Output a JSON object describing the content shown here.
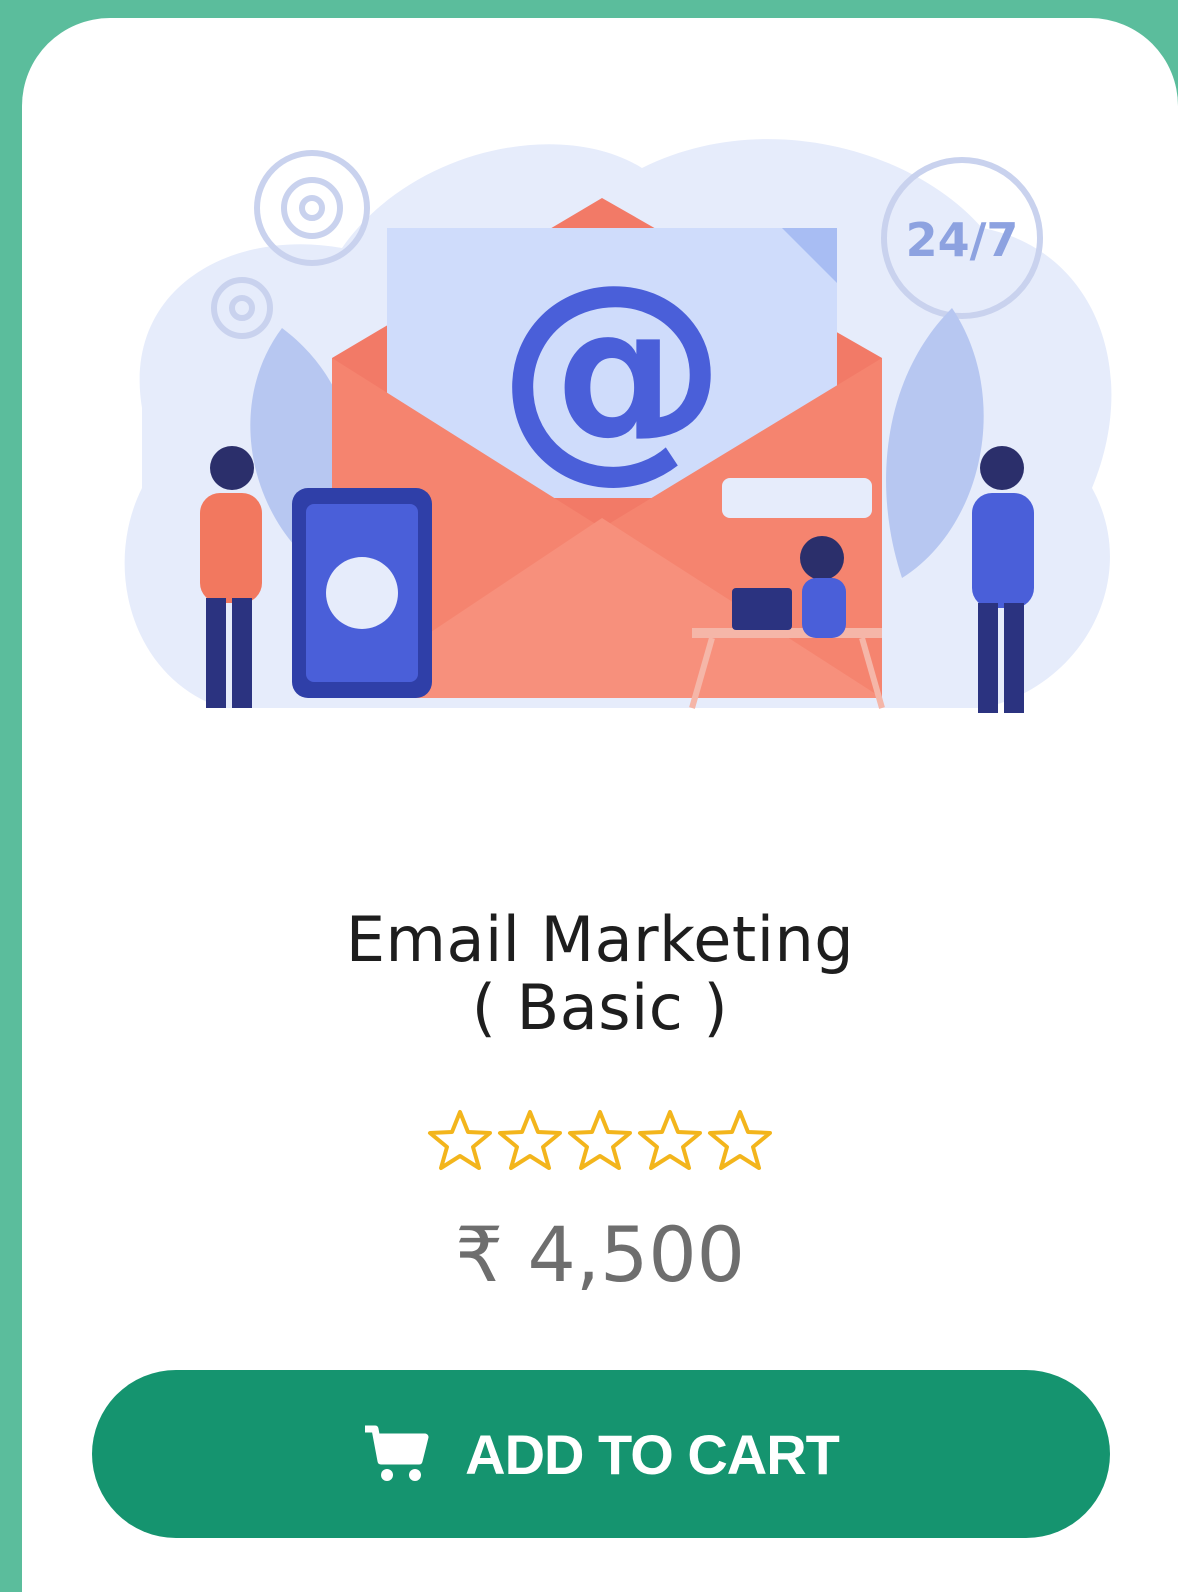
{
  "product": {
    "title_line1": "Email Marketing",
    "title_line2": "( Basic )",
    "rating": {
      "value": 0,
      "max": 5
    },
    "price": "₹ 4,500",
    "illustration_text": "24/7"
  },
  "actions": {
    "add_to_cart_label": "ADD TO CART",
    "cart_icon": "shopping-cart-icon"
  },
  "colors": {
    "page_background": "#5bbd9c",
    "card_background": "#ffffff",
    "button": "#15946f",
    "star_outline": "#f3b51c",
    "price_text": "#6e6e6e"
  }
}
